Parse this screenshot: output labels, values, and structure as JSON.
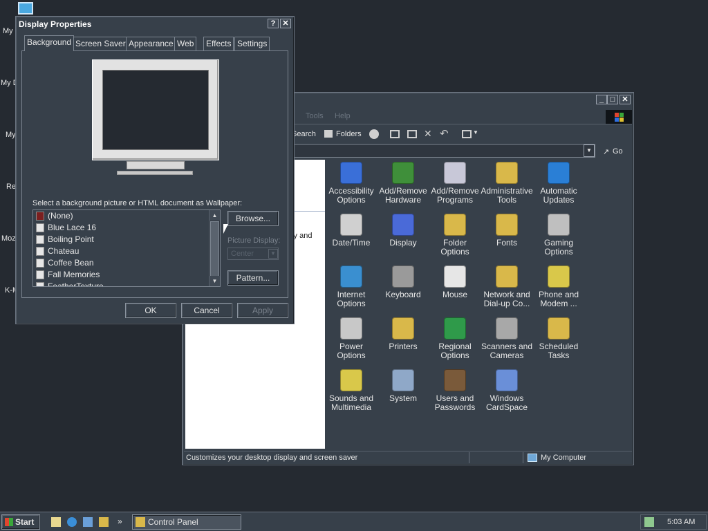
{
  "desktop": {
    "labels": [
      "My",
      "My D",
      "My",
      "Re",
      "Moz",
      "K-M"
    ]
  },
  "display_dialog": {
    "title": "Display Properties",
    "help_btn": "?",
    "close_btn": "✕",
    "tabs": [
      "Background",
      "Screen Saver",
      "Appearance",
      "Web",
      "Effects",
      "Settings"
    ],
    "wallpaper_prompt": "Select a background picture or HTML document as Wallpaper:",
    "wallpapers": [
      "(None)",
      "Blue Lace 16",
      "Boiling Point",
      "Chateau",
      "Coffee Bean",
      "Fall Memories",
      "FeatherTexture"
    ],
    "browse_btn": "Browse...",
    "picture_display_label": "Picture Display:",
    "picture_display_value": "Center",
    "pattern_btn": "Pattern...",
    "ok_btn": "OK",
    "cancel_btn": "Cancel",
    "apply_btn": "Apply"
  },
  "control_panel": {
    "menu_items": [
      "Tools",
      "Help"
    ],
    "toolbar": {
      "search": "Search",
      "folders": "Folders"
    },
    "go_btn": "Go",
    "left_pane_text": "lay and",
    "items": [
      {
        "label": "Accessibility Options",
        "color": "#3a6fd8"
      },
      {
        "label": "Add/Remove Hardware",
        "color": "#3f8f3a"
      },
      {
        "label": "Add/Remove Programs",
        "color": "#c8c8d8"
      },
      {
        "label": "Administrative Tools",
        "color": "#d9b84a"
      },
      {
        "label": "Automatic Updates",
        "color": "#2a7fd6"
      },
      {
        "label": "Date/Time",
        "color": "#d0d0d0"
      },
      {
        "label": "Display",
        "color": "#4a6ad8"
      },
      {
        "label": "Folder Options",
        "color": "#d9b84a"
      },
      {
        "label": "Fonts",
        "color": "#d9b84a"
      },
      {
        "label": "Gaming Options",
        "color": "#bfbfbf"
      },
      {
        "label": "Internet Options",
        "color": "#3a8fd0"
      },
      {
        "label": "Keyboard",
        "color": "#9a9a9a"
      },
      {
        "label": "Mouse",
        "color": "#e6e6e6"
      },
      {
        "label": "Network and Dial-up Co...",
        "color": "#d9b84a"
      },
      {
        "label": "Phone and Modem ...",
        "color": "#d9c84a"
      },
      {
        "label": "Power Options",
        "color": "#c8c8c8"
      },
      {
        "label": "Printers",
        "color": "#d9b84a"
      },
      {
        "label": "Regional Options",
        "color": "#2f9a4a"
      },
      {
        "label": "Scanners and Cameras",
        "color": "#a8a8a8"
      },
      {
        "label": "Scheduled Tasks",
        "color": "#d9b84a"
      },
      {
        "label": "Sounds and Multimedia",
        "color": "#d9c84a"
      },
      {
        "label": "System",
        "color": "#8fa8c8"
      },
      {
        "label": "Users and Passwords",
        "color": "#7a5a3a"
      },
      {
        "label": "Windows CardSpace",
        "color": "#6a8fd8"
      }
    ],
    "status_text": "Customizes your desktop display and screen saver",
    "status_location": "My Computer"
  },
  "taskbar": {
    "start": "Start",
    "quick_launch_more": "»",
    "task_label": "Control Panel",
    "clock": "5:03 AM"
  }
}
